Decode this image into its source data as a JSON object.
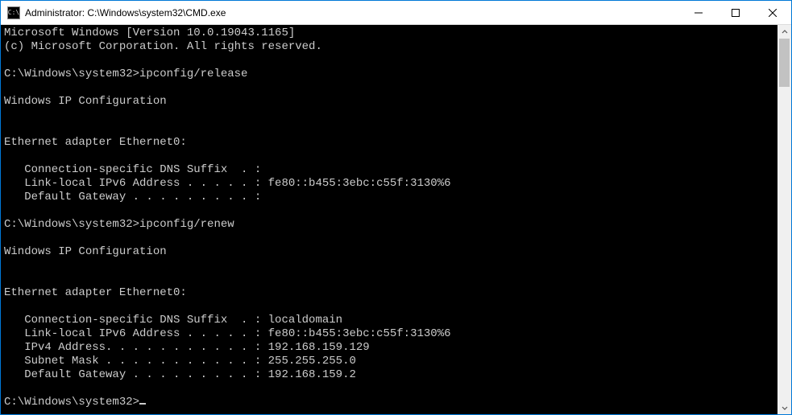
{
  "window": {
    "title": "Administrator: C:\\Windows\\system32\\CMD.exe",
    "icon_glyph": "C:\\"
  },
  "terminal": {
    "banner_line1": "Microsoft Windows [Version 10.0.19043.1165]",
    "banner_line2": "(c) Microsoft Corporation. All rights reserved.",
    "prompt": "C:\\Windows\\system32>",
    "cmd1": "ipconfig/release",
    "out1_header": "Windows IP Configuration",
    "out1_adapter": "Ethernet adapter Ethernet0:",
    "out1_l1": "   Connection-specific DNS Suffix  . :",
    "out1_l2": "   Link-local IPv6 Address . . . . . : fe80::b455:3ebc:c55f:3130%6",
    "out1_l3": "   Default Gateway . . . . . . . . . :",
    "cmd2": "ipconfig/renew",
    "out2_header": "Windows IP Configuration",
    "out2_adapter": "Ethernet adapter Ethernet0:",
    "out2_l1": "   Connection-specific DNS Suffix  . : localdomain",
    "out2_l2": "   Link-local IPv6 Address . . . . . : fe80::b455:3ebc:c55f:3130%6",
    "out2_l3": "   IPv4 Address. . . . . . . . . . . : 192.168.159.129",
    "out2_l4": "   Subnet Mask . . . . . . . . . . . : 255.255.255.0",
    "out2_l5": "   Default Gateway . . . . . . . . . : 192.168.159.2"
  }
}
